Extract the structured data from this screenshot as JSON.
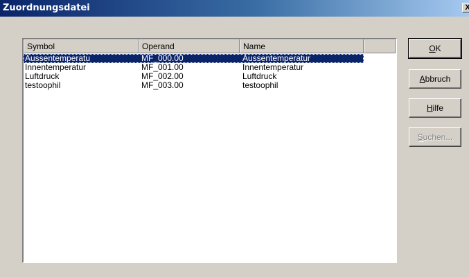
{
  "window": {
    "title": "Zuordnungsdatei",
    "close_glyph": "X"
  },
  "list": {
    "columns": [
      "Symbol",
      "Operand",
      "Name"
    ],
    "rows": [
      {
        "symbol": "Aussentemperatu",
        "operand": "MF_000.00",
        "name": "Aussentemperatur",
        "selected": true
      },
      {
        "symbol": "Innentemperatur",
        "operand": "MF_001.00",
        "name": "Innentemperatur",
        "selected": false
      },
      {
        "symbol": "Luftdruck",
        "operand": "MF_002.00",
        "name": "Luftdruck",
        "selected": false
      },
      {
        "symbol": "testoophil",
        "operand": "MF_003.00",
        "name": "testoophil",
        "selected": false
      }
    ]
  },
  "buttons": {
    "ok": {
      "accel": "O",
      "rest": "K"
    },
    "abbruch": {
      "accel": "A",
      "rest": "bbruch"
    },
    "hilfe": {
      "accel": "H",
      "rest": "ilfe"
    },
    "suchen": {
      "accel": "S",
      "rest": "uchen...",
      "enabled": false
    }
  },
  "colors": {
    "selection": "#0a246a",
    "face": "#d4d0c8"
  }
}
